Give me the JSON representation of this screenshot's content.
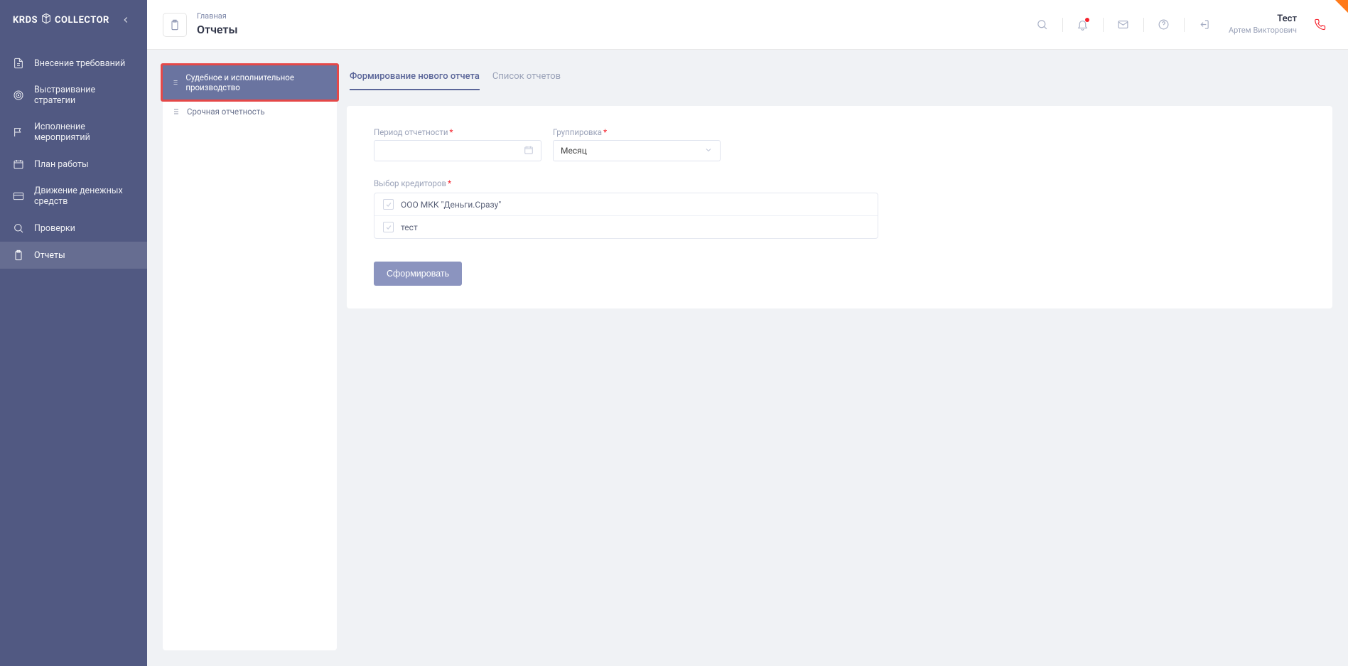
{
  "logo": {
    "part1": "KRDS",
    "part2": "COLLECTOR"
  },
  "sidebar": {
    "items": [
      {
        "label": "Внесение требований",
        "icon": "file-icon"
      },
      {
        "label": "Выстраивание стратегии",
        "icon": "target-icon"
      },
      {
        "label": "Исполнение мероприятий",
        "icon": "flag-icon"
      },
      {
        "label": "План работы",
        "icon": "calendar-icon"
      },
      {
        "label": "Движение денежных средств",
        "icon": "card-icon"
      },
      {
        "label": "Проверки",
        "icon": "search-icon"
      },
      {
        "label": "Отчеты",
        "icon": "clipboard-icon"
      }
    ],
    "activeIndex": 6
  },
  "breadcrumb": {
    "parent": "Главная",
    "title": "Отчеты"
  },
  "user": {
    "name": "Тест",
    "sub": "Артем Викторович"
  },
  "reportTypes": {
    "items": [
      {
        "label": "Судебное и исполнительное производство"
      },
      {
        "label": "Срочная отчетность"
      }
    ],
    "activeIndex": 0
  },
  "tabs": {
    "items": [
      {
        "label": "Формирование нового отчета"
      },
      {
        "label": "Список отчетов"
      }
    ],
    "activeIndex": 0
  },
  "form": {
    "period": {
      "label": "Период отчетности",
      "value": ""
    },
    "grouping": {
      "label": "Группировка",
      "value": "Месяц"
    },
    "creditors": {
      "label": "Выбор кредиторов",
      "items": [
        {
          "label": "ООО МКК \"Деньги.Сразу\"",
          "checked": true
        },
        {
          "label": "тест",
          "checked": true
        }
      ]
    },
    "submit": "Сформировать"
  }
}
